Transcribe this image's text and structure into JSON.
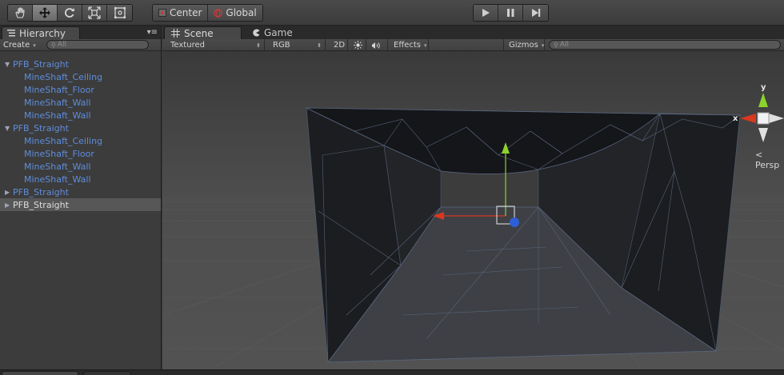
{
  "toolbar": {
    "transform_tools": [
      {
        "name": "hand-tool",
        "icon": "hand-icon",
        "active": false
      },
      {
        "name": "move-tool",
        "icon": "move-arrows-icon",
        "active": true
      },
      {
        "name": "rotate-tool",
        "icon": "rotate-icon",
        "active": false
      },
      {
        "name": "scale-tool",
        "icon": "scale-icon",
        "active": false
      },
      {
        "name": "rect-tool",
        "icon": "rect-icon",
        "active": false
      }
    ],
    "pivot_mode_label": "Center",
    "pivot_rotation_label": "Global",
    "play_controls": [
      "play-icon",
      "pause-icon",
      "step-icon"
    ]
  },
  "hierarchy": {
    "tab_label": "Hierarchy",
    "create_label": "Create",
    "search_placeholder": "All",
    "items": [
      {
        "label": "PFB_Straight",
        "expanded": true,
        "prefab": true
      },
      {
        "label": "MineShaft_Ceiling",
        "child": true
      },
      {
        "label": "MineShaft_Floor",
        "child": true
      },
      {
        "label": "MineShaft_Wall",
        "child": true
      },
      {
        "label": "MineShaft_Wall",
        "child": true
      },
      {
        "label": "PFB_Straight",
        "expanded": true,
        "prefab": true
      },
      {
        "label": "MineShaft_Ceiling",
        "child": true
      },
      {
        "label": "MineShaft_Floor",
        "child": true
      },
      {
        "label": "MineShaft_Wall",
        "child": true
      },
      {
        "label": "MineShaft_Wall",
        "child": true
      },
      {
        "label": "PFB_Straight",
        "expanded": false,
        "prefab": true
      },
      {
        "label": "PFB_Straight",
        "expanded": false,
        "selected": true
      }
    ]
  },
  "scene": {
    "tabs": [
      {
        "label": "Scene",
        "icon": "grid-icon",
        "active": true
      },
      {
        "label": "Game",
        "icon": "pacman-icon",
        "active": false
      }
    ],
    "draw_mode": "Textured",
    "render_mode": "RGB",
    "mode_2d_label": "2D",
    "effects_label": "Effects",
    "gizmos_label": "Gizmos",
    "search_placeholder": "All",
    "gizmo_axes": {
      "y": "y",
      "x": "x"
    },
    "projection_label": "Persp"
  },
  "colors": {
    "x_axis": "#d8381e",
    "y_axis": "#8bd22b",
    "z_axis": "#2d5fd8",
    "prefab_text": "#5f8ddb"
  }
}
